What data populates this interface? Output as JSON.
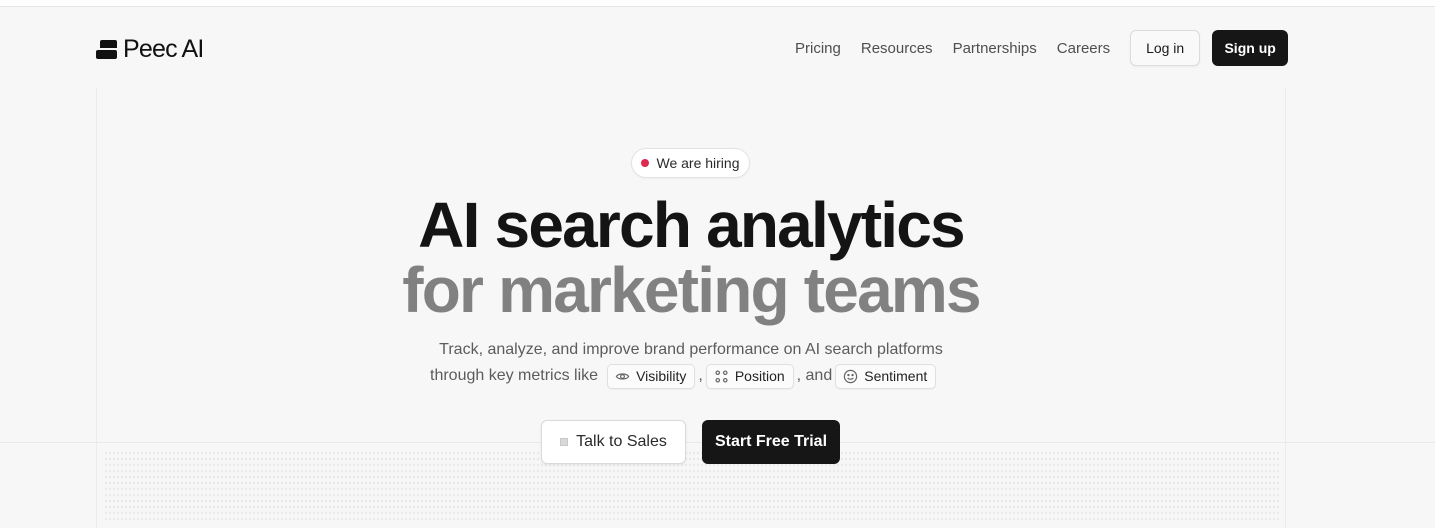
{
  "brand": {
    "name": "Peec AI"
  },
  "nav": {
    "links": [
      "Pricing",
      "Resources",
      "Partnerships",
      "Careers"
    ],
    "login_label": "Log in",
    "signup_label": "Sign up"
  },
  "hero": {
    "badge": "We are hiring",
    "headline_line1": "AI search analytics",
    "headline_line2": "for marketing teams",
    "subtext_line1": "Track, analyze, and improve brand performance on AI search platforms",
    "subtext_prefix": "through key metrics like",
    "metrics": [
      "Visibility",
      "Position",
      "Sentiment"
    ],
    "comma": ",",
    "and_text": ", and",
    "cta_secondary": "Talk to Sales",
    "cta_primary": "Start Free Trial"
  },
  "colors": {
    "accent_dot": "#e0294f",
    "primary_button": "#161616",
    "headline_muted": "#818181"
  },
  "icons": {
    "logo": "peec-logo-icon",
    "visibility": "eye-icon",
    "position": "position-grid-icon",
    "sentiment": "smile-icon"
  }
}
